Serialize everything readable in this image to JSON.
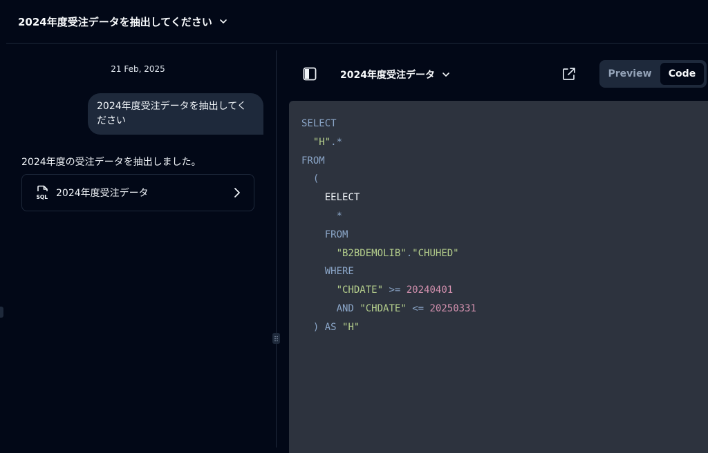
{
  "header": {
    "title": "2024年度受注データを抽出してください"
  },
  "chat": {
    "date": "21 Feb, 2025",
    "user_message": "2024年度受注データを抽出してください",
    "assistant_message": "2024年度の受注データを抽出しました。",
    "artifact_card": {
      "label": "2024年度受注データ",
      "icon": "sql-file-icon"
    }
  },
  "panel": {
    "title": "2024年度受注データ",
    "tabs": {
      "preview": "Preview",
      "code": "Code"
    },
    "active_tab": "Code"
  },
  "code": {
    "lines": [
      "SELECT",
      "  \"H\".*",
      "FROM",
      "  (",
      "    EELECT",
      "      *",
      "    FROM",
      "      \"B2BDEMOLIB\".\"CHUHED\"",
      "    WHERE",
      "      \"CHDATE\" >= 20240401",
      "      AND \"CHDATE\" <= 20250331",
      "  ) AS \"H\""
    ]
  },
  "colors": {
    "background": "#020817",
    "code_background": "#2d333e",
    "keyword": "#8ba6c8",
    "string": "#b5cf8c",
    "number": "#d592b0"
  }
}
